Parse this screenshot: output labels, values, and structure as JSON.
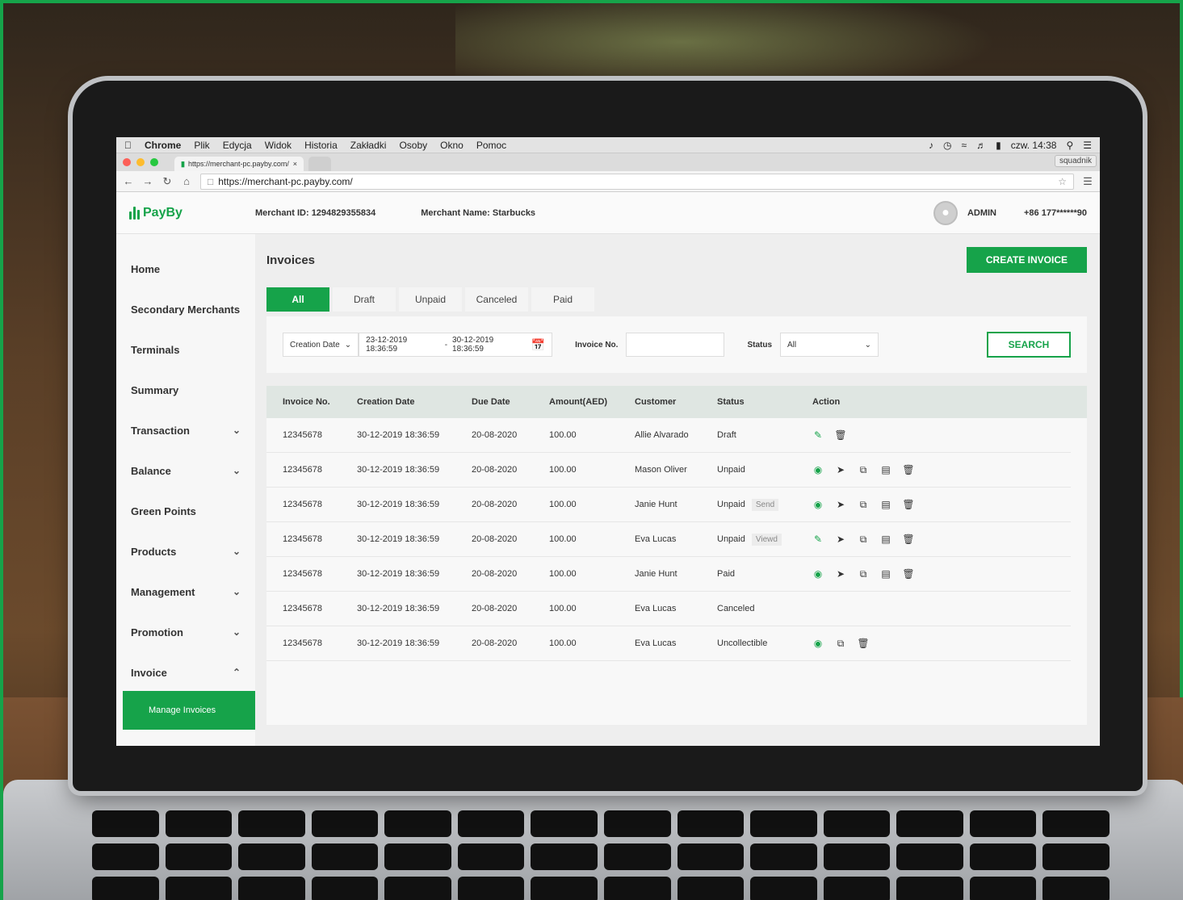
{
  "menubar": {
    "app": "Chrome",
    "items": [
      "Plik",
      "Edycja",
      "Widok",
      "Historia",
      "Zakładki",
      "Osoby",
      "Okno",
      "Pomoc"
    ],
    "clock": "czw. 14:38"
  },
  "browser": {
    "tab_title": "https://merchant-pc.payby.com/",
    "profile": "squadnik",
    "url": "https://merchant-pc.payby.com/"
  },
  "header": {
    "logo": "PayBy",
    "merchant_id_label": "Merchant ID:",
    "merchant_id": "1294829355834",
    "merchant_name_label": "Merchant Name:",
    "merchant_name": "Starbucks",
    "user": "ADMIN",
    "phone": "+86 177******90"
  },
  "sidebar": {
    "items": [
      {
        "label": "Home"
      },
      {
        "label": "Secondary Merchants"
      },
      {
        "label": "Terminals"
      },
      {
        "label": "Summary"
      },
      {
        "label": "Transaction"
      },
      {
        "label": "Balance"
      },
      {
        "label": "Green Points"
      },
      {
        "label": "Products"
      },
      {
        "label": "Management"
      },
      {
        "label": "Promotion"
      },
      {
        "label": "Invoice"
      }
    ],
    "sub_active": "Manage Invoices"
  },
  "main": {
    "title": "Invoices",
    "create_label": "CREATE INVOICE",
    "tabs": [
      "All",
      "Draft",
      "Unpaid",
      "Canceled",
      "Paid"
    ]
  },
  "filters": {
    "date_type": "Creation Date",
    "date_from": "23-12-2019 18:36:59",
    "date_sep": "-",
    "date_to": "30-12-2019 18:36:59",
    "invoice_label": "Invoice No.",
    "status_label": "Status",
    "status_value": "All",
    "search_label": "SEARCH"
  },
  "table": {
    "headers": [
      "Invoice No.",
      "Creation Date",
      "Due Date",
      "Amount(AED)",
      "Customer",
      "Status",
      "Action"
    ],
    "rows": [
      {
        "invoice": "12345678",
        "created": "30-12-2019 18:36:59",
        "due": "20-08-2020",
        "amount": "100.00",
        "customer": "Allie Alvarado",
        "status": "Draft",
        "tag": ""
      },
      {
        "invoice": "12345678",
        "created": "30-12-2019 18:36:59",
        "due": "20-08-2020",
        "amount": "100.00",
        "customer": "Mason Oliver",
        "status": "Unpaid",
        "tag": ""
      },
      {
        "invoice": "12345678",
        "created": "30-12-2019 18:36:59",
        "due": "20-08-2020",
        "amount": "100.00",
        "customer": "Janie Hunt",
        "status": "Unpaid",
        "tag": "Send"
      },
      {
        "invoice": "12345678",
        "created": "30-12-2019 18:36:59",
        "due": "20-08-2020",
        "amount": "100.00",
        "customer": "Eva Lucas",
        "status": "Unpaid",
        "tag": "Viewd"
      },
      {
        "invoice": "12345678",
        "created": "30-12-2019 18:36:59",
        "due": "20-08-2020",
        "amount": "100.00",
        "customer": "Janie Hunt",
        "status": "Paid",
        "tag": ""
      },
      {
        "invoice": "12345678",
        "created": "30-12-2019 18:36:59",
        "due": "20-08-2020",
        "amount": "100.00",
        "customer": "Eva Lucas",
        "status": "Canceled",
        "tag": ""
      },
      {
        "invoice": "12345678",
        "created": "30-12-2019 18:36:59",
        "due": "20-08-2020",
        "amount": "100.00",
        "customer": "Eva Lucas",
        "status": "Uncollectible",
        "tag": ""
      }
    ]
  },
  "colors": {
    "accent": "#16a34a",
    "text": "#333333",
    "header_row": "#dfe6e2"
  },
  "icons": [
    "apple-icon",
    "edit-icon",
    "delete-icon",
    "view-icon",
    "send-icon",
    "copy-icon",
    "receipt-icon",
    "calendar-icon",
    "chevron-down-icon",
    "chevron-up-icon",
    "star-icon",
    "menu-icon"
  ]
}
